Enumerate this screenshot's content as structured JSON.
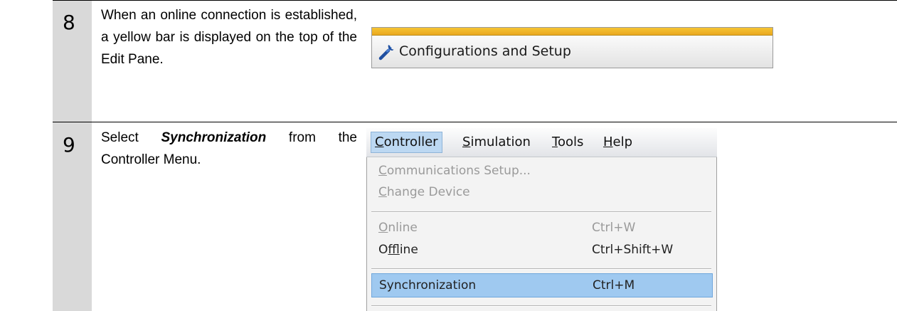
{
  "step8": {
    "number": "8",
    "text": "When an online connection is established, a yellow bar is displayed on the top of the Edit Pane.",
    "panel_title": "Configurations and Setup",
    "panel_icon": "wrench-icon",
    "bar_color": "#f0b428"
  },
  "step9": {
    "number": "9",
    "text_before": "Select ",
    "text_bold": "Synchronization",
    "text_after": " from the Controller Menu.",
    "menubar": {
      "controller": {
        "pre": "",
        "u": "C",
        "post": "ontroller"
      },
      "simulation": {
        "pre": "",
        "u": "S",
        "post": "imulation"
      },
      "tools": {
        "pre": "",
        "u": "T",
        "post": "ools"
      },
      "help": {
        "pre": "",
        "u": "H",
        "post": "elp"
      }
    },
    "menu_items": {
      "communications": {
        "u": "C",
        "post": "ommunications Setup..."
      },
      "change_device": {
        "u": "C",
        "post": "hange Device"
      },
      "online": {
        "u": "O",
        "post": "nline",
        "shortcut": "Ctrl+W"
      },
      "offline": {
        "pre": "O",
        "u": "f",
        "post": "fline",
        "shortcut": "Ctrl+Shift+W"
      },
      "synchronization": {
        "label": "Synchronization",
        "shortcut": "Ctrl+M"
      }
    },
    "highlight_color": "#9fc9f0"
  }
}
